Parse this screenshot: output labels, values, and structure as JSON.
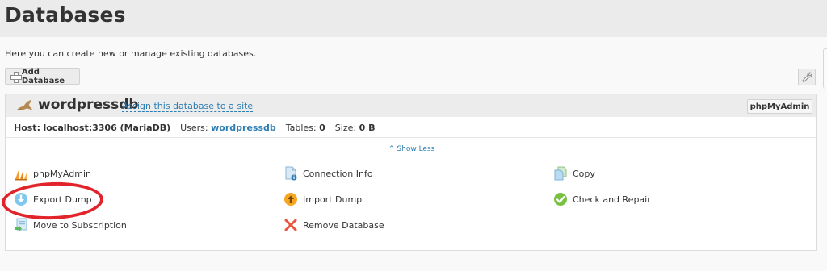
{
  "page": {
    "title": "Databases",
    "intro": "Here you can create new or manage existing databases."
  },
  "toolbar": {
    "add_database_label": "Add Database",
    "settings_icon": "wrench-icon"
  },
  "database": {
    "name": "wordpressdb",
    "assign_link": "Assign this database to a site",
    "phpmyadmin_button": "phpMyAdmin",
    "stats": {
      "host_label": "Host:",
      "host_value": "localhost:3306 (MariaDB)",
      "users_label": "Users:",
      "users_value": "wordpressdb",
      "tables_label": "Tables:",
      "tables_value": "0",
      "size_label": "Size:",
      "size_value": "0 B"
    },
    "show_less": "Show Less",
    "actions": [
      {
        "label": "phpMyAdmin",
        "icon": "phpmyadmin-sail-icon"
      },
      {
        "label": "Connection Info",
        "icon": "connection-info-icon"
      },
      {
        "label": "Copy",
        "icon": "copy-icon"
      },
      {
        "label": "Export Dump",
        "icon": "export-dump-icon"
      },
      {
        "label": "Import Dump",
        "icon": "import-dump-icon"
      },
      {
        "label": "Check and Repair",
        "icon": "check-repair-icon"
      },
      {
        "label": "Move to Subscription",
        "icon": "move-subscription-icon"
      },
      {
        "label": "Remove Database",
        "icon": "remove-database-icon"
      }
    ]
  },
  "colors": {
    "link": "#2b7db4",
    "highlight": "#e2232a",
    "check_green": "#7ac143",
    "remove_red": "#e8563f",
    "import_orange": "#f5a623",
    "export_blue": "#7fc7ef"
  }
}
